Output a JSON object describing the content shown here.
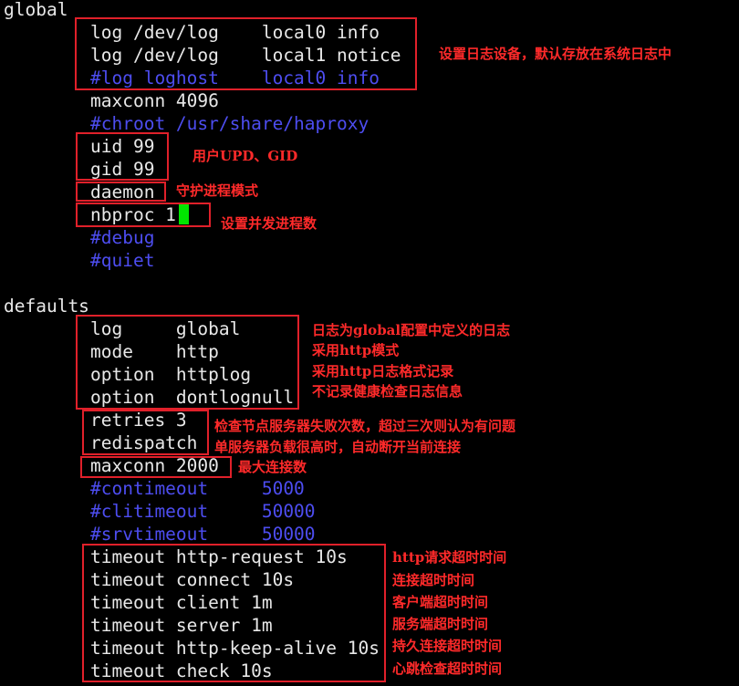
{
  "lines": [
    {
      "text": "global",
      "indent": false,
      "comment": false
    },
    {
      "text": "log /dev/log    local0 info",
      "indent": true,
      "comment": false
    },
    {
      "text": "log /dev/log    local1 notice",
      "indent": true,
      "comment": false
    },
    {
      "text": "#log loghost    local0 info",
      "indent": true,
      "comment": true
    },
    {
      "text": "maxconn 4096",
      "indent": true,
      "comment": false
    },
    {
      "text": "#chroot /usr/share/haproxy",
      "indent": true,
      "comment": true
    },
    {
      "text": "uid 99",
      "indent": true,
      "comment": false
    },
    {
      "text": "gid 99",
      "indent": true,
      "comment": false
    },
    {
      "text": "daemon",
      "indent": true,
      "comment": false
    },
    {
      "text": "nbproc 1",
      "indent": true,
      "comment": false
    },
    {
      "text": "#debug",
      "indent": true,
      "comment": true
    },
    {
      "text": "#quiet",
      "indent": true,
      "comment": true
    },
    {
      "text": "",
      "indent": false,
      "comment": false
    },
    {
      "text": "defaults",
      "indent": false,
      "comment": false
    },
    {
      "text": "log     global",
      "indent": true,
      "comment": false
    },
    {
      "text": "mode    http",
      "indent": true,
      "comment": false
    },
    {
      "text": "option  httplog",
      "indent": true,
      "comment": false
    },
    {
      "text": "option  dontlognull",
      "indent": true,
      "comment": false
    },
    {
      "text": "retries 3",
      "indent": true,
      "comment": false
    },
    {
      "text": "redispatch",
      "indent": true,
      "comment": false
    },
    {
      "text": "maxconn 2000",
      "indent": true,
      "comment": false
    },
    {
      "text": "#contimeout     5000",
      "indent": true,
      "comment": true
    },
    {
      "text": "#clitimeout     50000",
      "indent": true,
      "comment": true
    },
    {
      "text": "#srvtimeout     50000",
      "indent": true,
      "comment": true
    },
    {
      "text": "timeout http-request 10s",
      "indent": true,
      "comment": false
    },
    {
      "text": "timeout connect 10s",
      "indent": true,
      "comment": false
    },
    {
      "text": "timeout client 1m",
      "indent": true,
      "comment": false
    },
    {
      "text": "timeout server 1m",
      "indent": true,
      "comment": false
    },
    {
      "text": "timeout http-keep-alive 10s",
      "indent": true,
      "comment": false
    },
    {
      "text": "timeout check 10s",
      "indent": true,
      "comment": false
    }
  ],
  "annotations": {
    "log_device": "设置日志设备，默认存放在系统日志中",
    "uid_gid": "用户UPD、GID",
    "daemon": "守护进程模式",
    "nbproc": "设置并发进程数",
    "log_global": "日志为global配置中定义的日志",
    "mode_http": "采用http模式",
    "option_httplog": "采用http日志格式记录",
    "option_dontlognull": "不记录健康检查日志信息",
    "retries": "检查节点服务器失败次数，超过三次则认为有问题",
    "redispatch": "单服务器负载很高时，自动断开当前连接",
    "maxconn": "最大连接数",
    "timeout_http_request": "http请求超时时间",
    "timeout_connect": "连接超时时间",
    "timeout_client": "客户端超时时间",
    "timeout_server": "服务端超时时间",
    "timeout_keep_alive": "持久连接超时时间",
    "timeout_check": "心跳检查超时时间"
  },
  "colors": {
    "text": "#e8e8e8",
    "comment": "#4d4df0",
    "highlight": "#e0202a",
    "cursor": "#00e600",
    "background": "#000000"
  }
}
